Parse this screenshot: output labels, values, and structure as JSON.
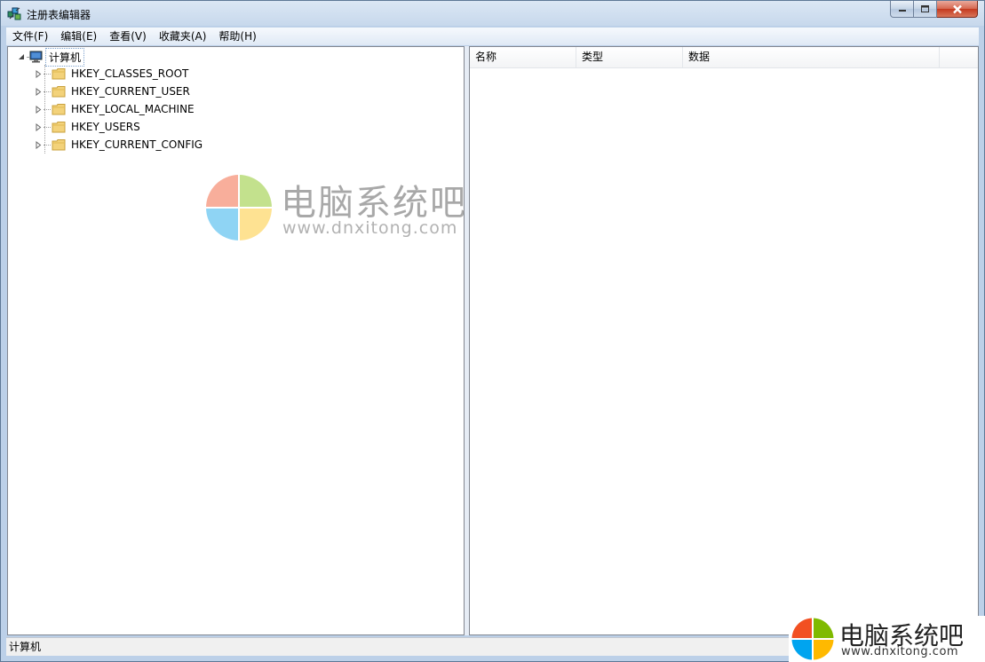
{
  "window": {
    "title": "注册表编辑器"
  },
  "menu": {
    "items": [
      {
        "label": "文件(F)"
      },
      {
        "label": "编辑(E)"
      },
      {
        "label": "查看(V)"
      },
      {
        "label": "收藏夹(A)"
      },
      {
        "label": "帮助(H)"
      }
    ]
  },
  "tree": {
    "root": "计算机",
    "keys": [
      {
        "label": "HKEY_CLASSES_ROOT"
      },
      {
        "label": "HKEY_CURRENT_USER"
      },
      {
        "label": "HKEY_LOCAL_MACHINE"
      },
      {
        "label": "HKEY_USERS"
      },
      {
        "label": "HKEY_CURRENT_CONFIG"
      }
    ]
  },
  "list": {
    "columns": [
      {
        "label": "名称"
      },
      {
        "label": "类型"
      },
      {
        "label": "数据"
      }
    ]
  },
  "status": {
    "path": "计算机"
  },
  "watermark": {
    "brand": "电脑系统吧",
    "url": "www.dnxitong.com",
    "colors": [
      "#f25022",
      "#7fba00",
      "#00a4ef",
      "#ffb900"
    ]
  }
}
